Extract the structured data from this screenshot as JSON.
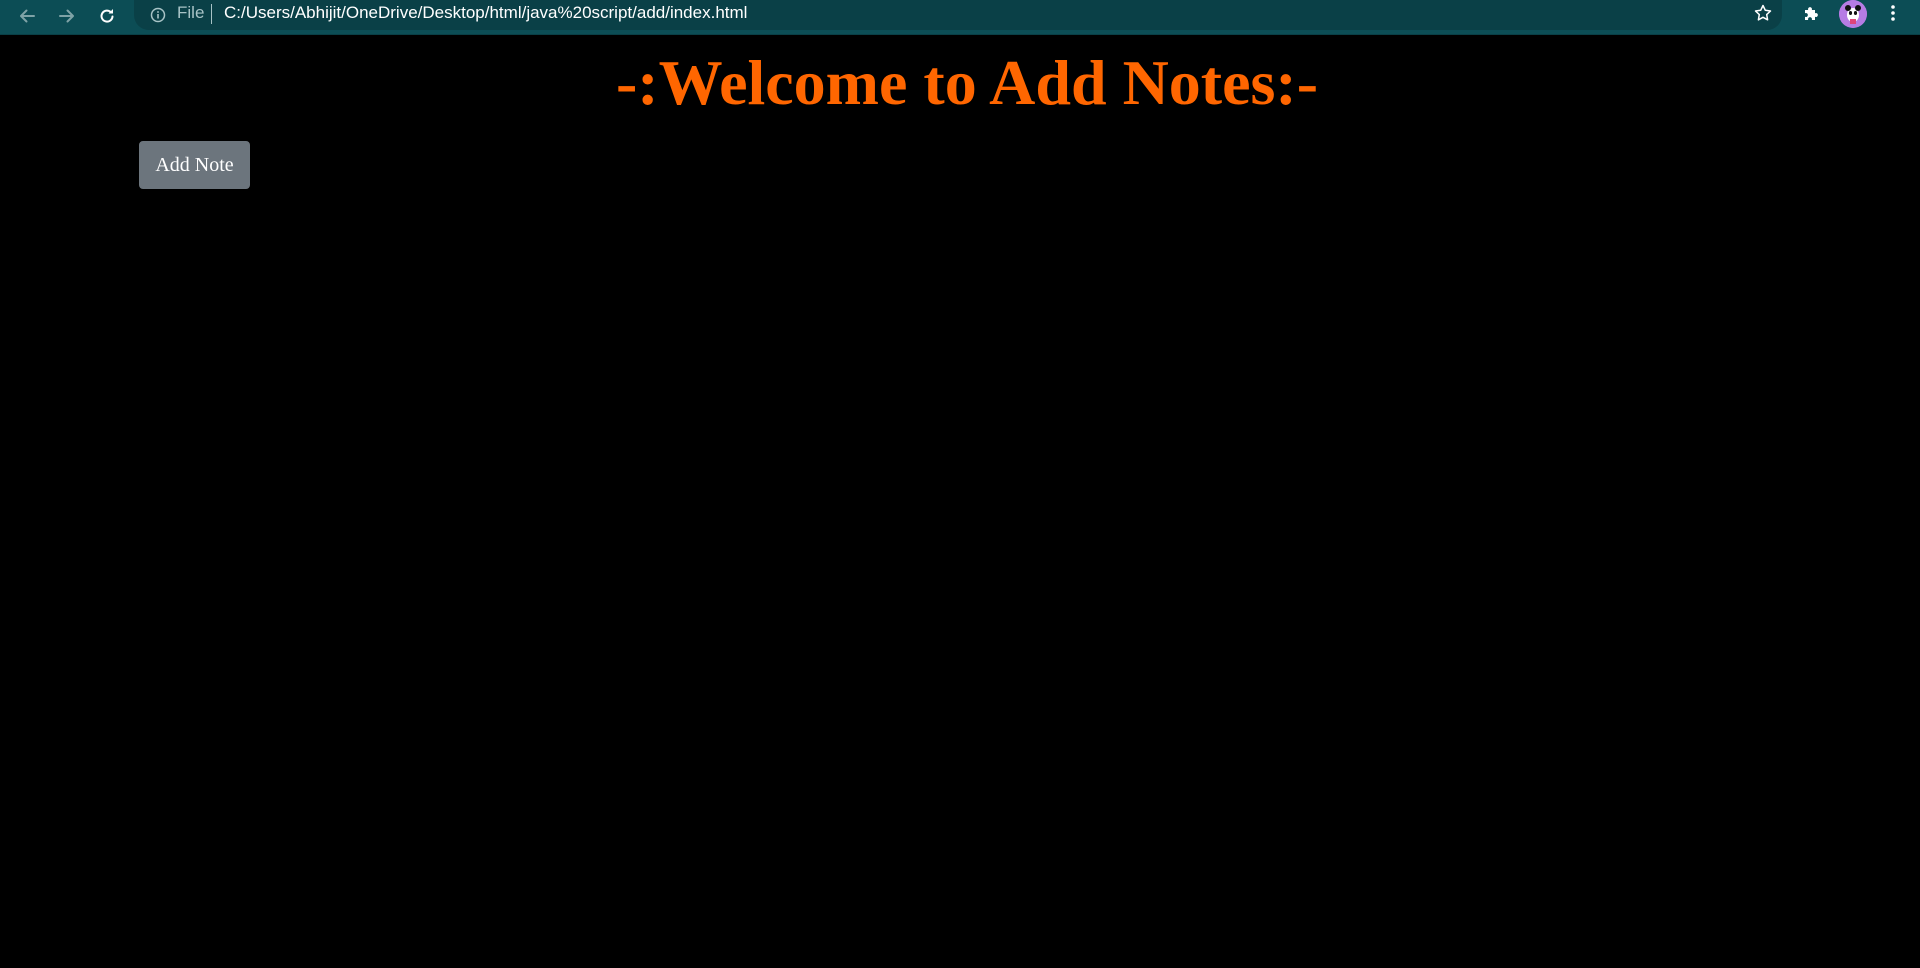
{
  "browser": {
    "scheme_label": "File",
    "url": "C:/Users/Abhijit/OneDrive/Desktop/html/java%20script/add/index.html",
    "icons": {
      "back": "back-arrow-icon",
      "forward": "forward-arrow-icon",
      "reload": "reload-icon",
      "site_info": "info-icon",
      "bookmark": "star-icon",
      "extensions": "puzzle-icon",
      "profile": "avatar",
      "menu": "kebab-menu-icon"
    },
    "colors": {
      "toolbar": "#0c4d55",
      "omnibox": "#0a4047"
    }
  },
  "page": {
    "title": "-:Welcome to Add Notes:-",
    "add_button_label": "Add Note",
    "colors": {
      "background": "#000000",
      "title": "#ff6600",
      "button": "#6c757d",
      "button_text": "#ffffff"
    }
  }
}
